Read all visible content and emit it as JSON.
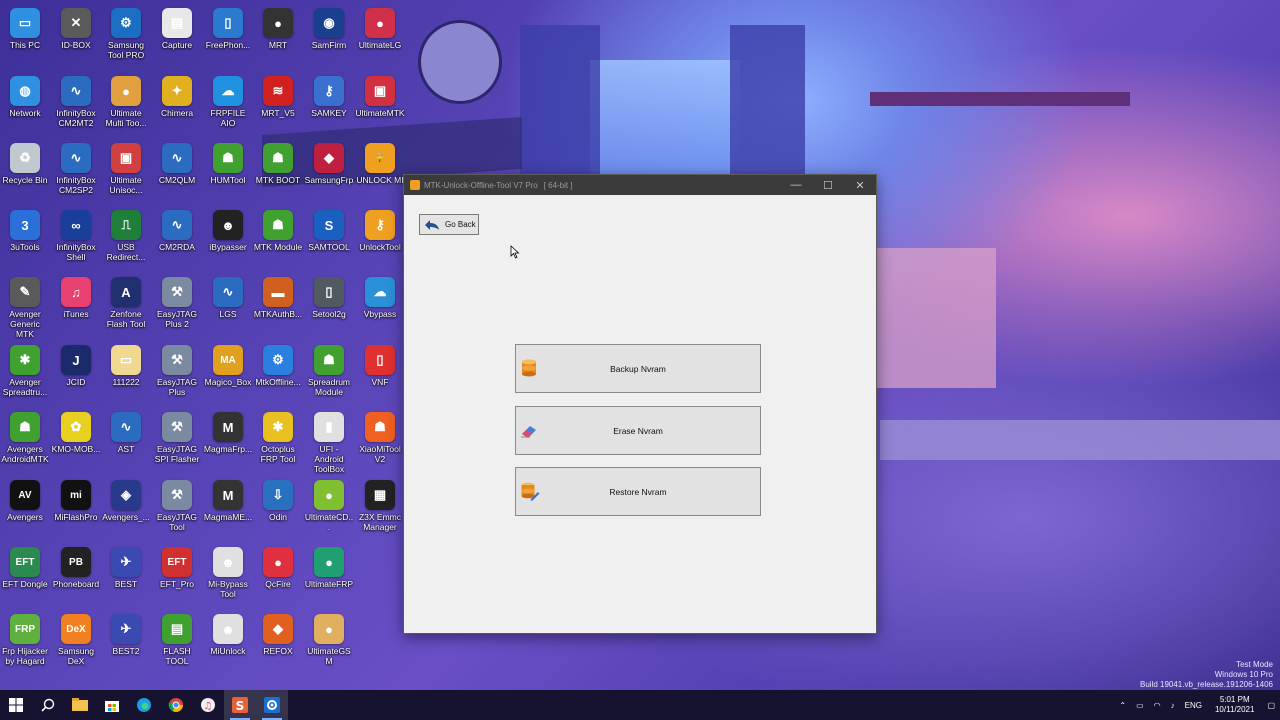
{
  "desktop_icons": [
    {
      "label": "This PC",
      "color": "#2f8fe0",
      "glyph": "▭"
    },
    {
      "label": "ID-BOX",
      "color": "#5a5a5a",
      "glyph": "✕"
    },
    {
      "label": "Samsung Tool PRO",
      "color": "#1a6fc4",
      "glyph": "⚙"
    },
    {
      "label": "Capture",
      "color": "#e8e8e8",
      "glyph": "▤"
    },
    {
      "label": "FreePhon...",
      "color": "#2a7bd0",
      "glyph": "▯"
    },
    {
      "label": "MRT",
      "color": "#333333",
      "glyph": "●"
    },
    {
      "label": "SamFirm",
      "color": "#1b3f8f",
      "glyph": "◉"
    },
    {
      "label": "UltimateLG",
      "color": "#d0304a",
      "glyph": "●"
    },
    {
      "label": "Network",
      "color": "#2f8fe0",
      "glyph": "◍"
    },
    {
      "label": "InfinityBox CM2MT2",
      "color": "#2b6cc0",
      "glyph": "∿"
    },
    {
      "label": "Ultimate Multi Too...",
      "color": "#e0a040",
      "glyph": "●"
    },
    {
      "label": "Chimera",
      "color": "#e0b020",
      "glyph": "✦"
    },
    {
      "label": "FRPFILE AIO",
      "color": "#2090e0",
      "glyph": "☁"
    },
    {
      "label": "MRT_V5",
      "color": "#d02020",
      "glyph": "≋"
    },
    {
      "label": "SAMKEY",
      "color": "#3a70d0",
      "glyph": "⚷"
    },
    {
      "label": "UltimateMTK",
      "color": "#d03040",
      "glyph": "▣"
    },
    {
      "label": "Recycle Bin",
      "color": "#c0c8d0",
      "glyph": "♻"
    },
    {
      "label": "InfinityBox CM2SP2",
      "color": "#2b6cc0",
      "glyph": "∿"
    },
    {
      "label": "Ultimate Unisoc...",
      "color": "#d04040",
      "glyph": "▣"
    },
    {
      "label": "CM2QLM",
      "color": "#2b6cc0",
      "glyph": "∿"
    },
    {
      "label": "HUMTool",
      "color": "#40a030",
      "glyph": "☗"
    },
    {
      "label": "MTK BOOT",
      "color": "#40a030",
      "glyph": "☗"
    },
    {
      "label": "SamsungFrp",
      "color": "#c02040",
      "glyph": "◆"
    },
    {
      "label": "UNLOCK MI",
      "color": "#f0a020",
      "glyph": "🔒"
    },
    {
      "label": "3uTools",
      "color": "#2a70d8",
      "glyph": "3"
    },
    {
      "label": "InfinityBox Shell",
      "color": "#1a3f9a",
      "glyph": "∞"
    },
    {
      "label": "USB Redirect...",
      "color": "#1f7f3a",
      "glyph": "⎍"
    },
    {
      "label": "CM2RDA",
      "color": "#2b6cc0",
      "glyph": "∿"
    },
    {
      "label": "iBypasser",
      "color": "#222222",
      "glyph": "☻"
    },
    {
      "label": "MTK Module",
      "color": "#40a030",
      "glyph": "☗"
    },
    {
      "label": "SAMTOOL",
      "color": "#1a60c0",
      "glyph": "S"
    },
    {
      "label": "UnlockTool",
      "color": "#f0a020",
      "glyph": "⚷"
    },
    {
      "label": "Avenger Generic MTK",
      "color": "#5a5a5a",
      "glyph": "✎"
    },
    {
      "label": "iTunes",
      "color": "#e84070",
      "glyph": "♫"
    },
    {
      "label": "Zenfone Flash Tool",
      "color": "#1f2f6f",
      "glyph": "A"
    },
    {
      "label": "EasyJTAG Plus 2",
      "color": "#7a8aa0",
      "glyph": "⚒"
    },
    {
      "label": "LGS",
      "color": "#2b6cc0",
      "glyph": "∿"
    },
    {
      "label": "MTKAuthB...",
      "color": "#d06020",
      "glyph": "▬"
    },
    {
      "label": "Setool2g",
      "color": "#505a60",
      "glyph": "▯"
    },
    {
      "label": "Vbypass",
      "color": "#2a90d8",
      "glyph": "☁"
    },
    {
      "label": "Avenger Spreadtru...",
      "color": "#40a030",
      "glyph": "✱"
    },
    {
      "label": "JCID",
      "color": "#1a2a6a",
      "glyph": "J"
    },
    {
      "label": "111222",
      "color": "#f0d890",
      "glyph": "▭"
    },
    {
      "label": "EasyJTAG Plus",
      "color": "#7a8aa0",
      "glyph": "⚒"
    },
    {
      "label": "Magico_Box",
      "color": "#e0a020",
      "glyph": "MA"
    },
    {
      "label": "MtkOffline...",
      "color": "#2a80e0",
      "glyph": "⚙"
    },
    {
      "label": "Spreadrum Module",
      "color": "#40a030",
      "glyph": "☗"
    },
    {
      "label": "VNF",
      "color": "#e03030",
      "glyph": "▯"
    },
    {
      "label": "Avengers AndroidMTK",
      "color": "#40a030",
      "glyph": "☗"
    },
    {
      "label": "KMO-MOB...",
      "color": "#e8d020",
      "glyph": "✿"
    },
    {
      "label": "AST",
      "color": "#2b6cc0",
      "glyph": "∿"
    },
    {
      "label": "EasyJTAG SPI Flasher",
      "color": "#7a8aa0",
      "glyph": "⚒"
    },
    {
      "label": "MagmaFrp...",
      "color": "#333333",
      "glyph": "M"
    },
    {
      "label": "Octoplus FRP Tool",
      "color": "#e8c020",
      "glyph": "✱"
    },
    {
      "label": "UFI - Android ToolBox",
      "color": "#e0e0e0",
      "glyph": "▮"
    },
    {
      "label": "XiaoMiTool V2",
      "color": "#f06020",
      "glyph": "☗"
    },
    {
      "label": "Avengers",
      "color": "#111111",
      "glyph": "AV"
    },
    {
      "label": "MiFlashPro",
      "color": "#111111",
      "glyph": "mi"
    },
    {
      "label": "Avengers_...",
      "color": "#2a3a8a",
      "glyph": "◈"
    },
    {
      "label": "EasyJTAG Tool",
      "color": "#7a8aa0",
      "glyph": "⚒"
    },
    {
      "label": "MagmaME...",
      "color": "#333333",
      "glyph": "M"
    },
    {
      "label": "Odin",
      "color": "#2a70c0",
      "glyph": "⇩"
    },
    {
      "label": "UltimateCD...",
      "color": "#80c030",
      "glyph": "●"
    },
    {
      "label": "Z3X Emmc Manager",
      "color": "#222222",
      "glyph": "▦"
    },
    {
      "label": "EFT Dongle",
      "color": "#2a8a50",
      "glyph": "EFT"
    },
    {
      "label": "Phoneboard",
      "color": "#222222",
      "glyph": "PB"
    },
    {
      "label": "BEST",
      "color": "#3a4ab0",
      "glyph": "✈"
    },
    {
      "label": "EFT_Pro",
      "color": "#d03030",
      "glyph": "EFT"
    },
    {
      "label": "Mi-Bypass Tool",
      "color": "#e0e0e0",
      "glyph": "☻"
    },
    {
      "label": "QcFire",
      "color": "#e03040",
      "glyph": "●"
    },
    {
      "label": "UltimateFRP",
      "color": "#20a070",
      "glyph": "●"
    },
    {
      "label": "Frp Hijacker by Hagard",
      "color": "#60b040",
      "glyph": "FRP"
    },
    {
      "label": "Samsung DeX",
      "color": "#f08020",
      "glyph": "DeX"
    },
    {
      "label": "BEST2",
      "color": "#3a4ab0",
      "glyph": "✈"
    },
    {
      "label": "FLASH TOOL",
      "color": "#40a030",
      "glyph": "▤"
    },
    {
      "label": "MiUnlock",
      "color": "#e0e0e0",
      "glyph": "☻"
    },
    {
      "label": "REFOX",
      "color": "#e06020",
      "glyph": "◆"
    },
    {
      "label": "UltimateGSM",
      "color": "#e0b060",
      "glyph": "●"
    }
  ],
  "app_window": {
    "title": "MTK-Unlock-Offline-Tool V7 Pro",
    "bits": "[ 64-bit ]",
    "controls": {
      "minimize": "—",
      "maximize": "☐",
      "close": "✕"
    },
    "go_back": "Go Back",
    "buttons": [
      {
        "label": "Backup Nvram",
        "icon": "database-icon"
      },
      {
        "label": "Erase Nvram",
        "icon": "eraser-icon"
      },
      {
        "label": "Restore Nvram",
        "icon": "database-edit-icon"
      }
    ]
  },
  "watermark": {
    "line1": "Test Mode",
    "line2": "Windows 10 Pro",
    "line3": "Build 19041.vb_release.191206-1406"
  },
  "taskbar": {
    "items": [
      "start-icon",
      "search-icon",
      "file-explorer-icon",
      "store-icon",
      "edge-icon",
      "chrome-icon",
      "itunes-icon",
      "s-app-icon",
      "gear-app-icon"
    ],
    "tray": {
      "language": "ENG",
      "time": "5:01 PM",
      "date": "10/11/2021"
    }
  }
}
